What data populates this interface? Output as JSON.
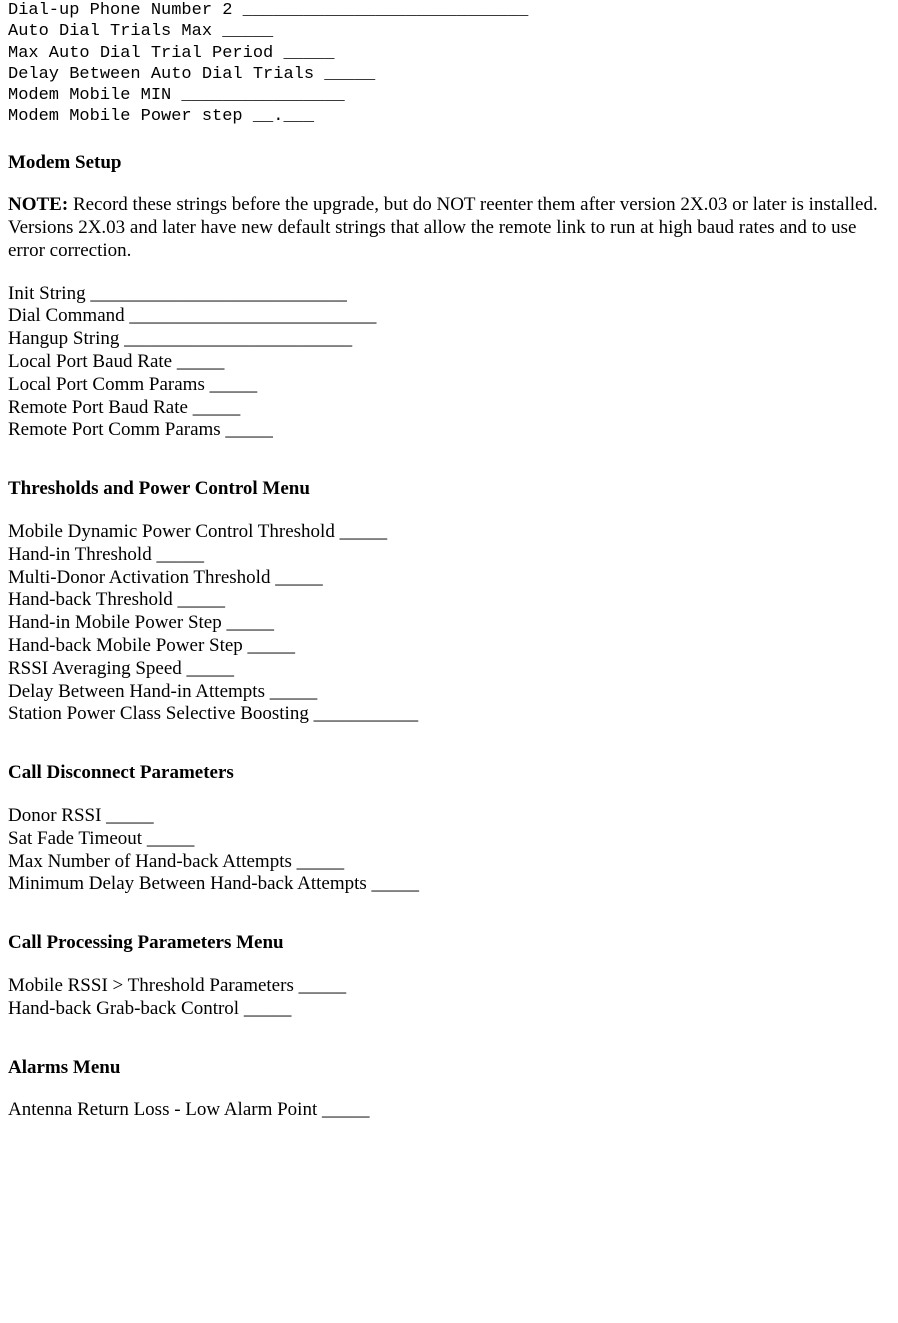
{
  "mono_fields": [
    "Dial-up Phone Number 2 ____________________________",
    "Auto Dial Trials Max _____",
    "Max Auto Dial Trial Period _____",
    "Delay Between Auto Dial Trials _____",
    "Modem Mobile MIN ________________",
    "Modem Mobile Power step __.___"
  ],
  "modem_setup": {
    "title": "Modem Setup",
    "note_label": "NOTE:",
    "note_body": "  Record these strings before the upgrade, but do NOT reenter them after version 2X.03 or later is installed.  Versions 2X.03 and later have new default strings that allow the remote link to run at high baud rates and to use error correction.",
    "fields": [
      "Init String ___________________________",
      "Dial Command __________________________",
      "Hangup String ________________________",
      "Local Port Baud Rate _____",
      "Local Port Comm Params _____",
      "Remote Port Baud Rate _____",
      "Remote Port Comm Params _____"
    ]
  },
  "thresholds": {
    "title": "Thresholds and Power Control Menu",
    "fields": [
      "Mobile Dynamic Power Control Threshold _____",
      "Hand-in Threshold _____",
      "Multi-Donor Activation Threshold _____",
      "Hand-back Threshold _____",
      "Hand-in Mobile Power Step _____",
      "Hand-back Mobile Power Step _____",
      "RSSI Averaging Speed _____",
      "Delay Between Hand-in Attempts _____",
      "Station Power Class Selective Boosting ___________"
    ]
  },
  "call_disconnect": {
    "title": "Call Disconnect Parameters",
    "fields": [
      "Donor RSSI _____",
      "Sat Fade Timeout _____",
      "Max Number of Hand-back Attempts _____",
      "Minimum Delay Between Hand-back Attempts _____"
    ]
  },
  "call_processing": {
    "title": "Call Processing Parameters Menu",
    "fields": [
      "Mobile RSSI > Threshold Parameters _____",
      "Hand-back Grab-back Control _____"
    ]
  },
  "alarms": {
    "title": "Alarms Menu",
    "fields": [
      "Antenna Return Loss - Low Alarm Point _____"
    ]
  }
}
